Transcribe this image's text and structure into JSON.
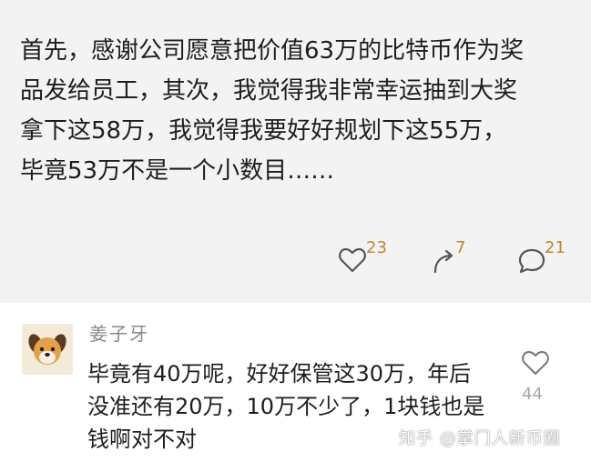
{
  "post": {
    "text": "首先，感谢公司愿意把价值63万的比特币作为奖\n品发给员工，其次，我觉得我非常幸运抽到大奖\n拿下这58万，我觉得我要好好规划下这55万，\n毕竟53万不是一个小数目……",
    "like_count": "23",
    "share_count": "7",
    "comment_count": "21",
    "like_icon": "heart-icon",
    "share_icon": "share-arrow-icon",
    "comment_icon": "comment-bubble-icon",
    "accent_color": "#b8892c"
  },
  "reply": {
    "username": "姜子牙",
    "avatar_icon": "dog-avatar-icon",
    "text": "毕竟有40万呢，好好保管这30万，年后\n没准还有20万，10万不少了，1块钱也是\n钱啊对不对",
    "like_count": "44",
    "like_icon": "heart-outline-icon"
  },
  "watermark": "知乎 @掌门人新币圈"
}
